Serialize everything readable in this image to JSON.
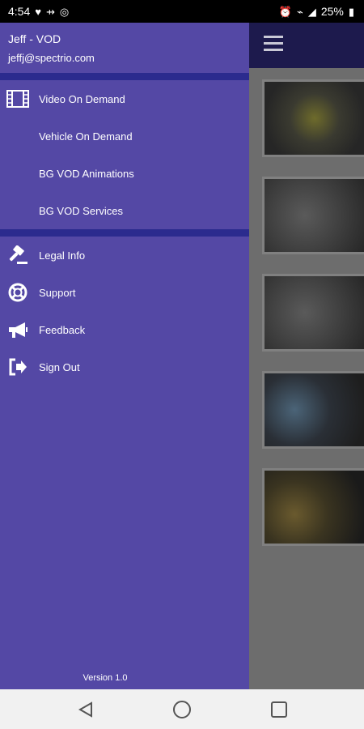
{
  "status_bar": {
    "time": "4:54",
    "battery": "25%"
  },
  "drawer": {
    "user_name": "Jeff - VOD",
    "user_email": "jeffj@spectrio.com",
    "sections": [
      {
        "items": [
          {
            "label": "Video On Demand",
            "icon": "film-icon"
          },
          {
            "label": "Vehicle On Demand",
            "icon": ""
          },
          {
            "label": "BG VOD Animations",
            "icon": ""
          },
          {
            "label": "BG VOD Services",
            "icon": ""
          }
        ]
      },
      {
        "items": [
          {
            "label": "Legal Info",
            "icon": "gavel-icon"
          },
          {
            "label": "Support",
            "icon": "lifebuoy-icon"
          },
          {
            "label": "Feedback",
            "icon": "megaphone-icon"
          },
          {
            "label": "Sign Out",
            "icon": "sign-out-icon"
          }
        ]
      }
    ],
    "version": "Version 1.0"
  },
  "colors": {
    "drawer_bg": "#5448a5",
    "divider": "#2b2b8e",
    "appbar": "#1d1a4d",
    "scrim": "#6d6d6d"
  }
}
